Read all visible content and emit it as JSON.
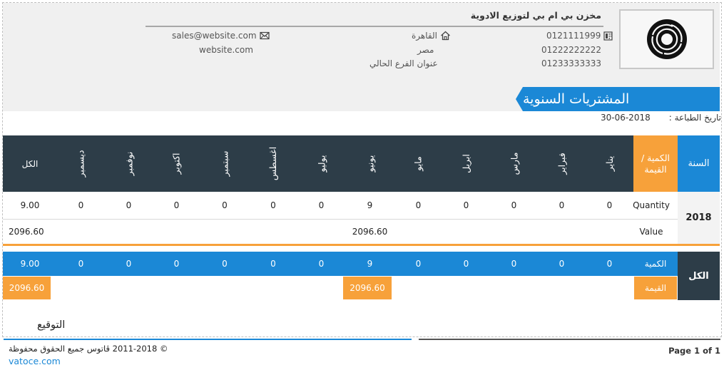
{
  "company": {
    "name": "مخزن بي ام بي لتوزيع الادوية",
    "phone1": "0121111999",
    "phone2": "01222222222",
    "phone3": "01233333333",
    "city": "القاهرة",
    "country": "مصر",
    "branch_address": "عنوان الفرع الحالي",
    "email": "sales@website.com",
    "website": "website.com"
  },
  "report": {
    "title": "المشتريات السنوية",
    "print_date_label": "تاريخ الطباعة :",
    "print_date": "30-06-2018"
  },
  "table": {
    "year_header": "السنة",
    "qv_header": "الكمية / القيمة",
    "months": [
      "يناير",
      "فبراير",
      "مارس",
      "ابريل",
      "مايو",
      "يونيو",
      "يوليو",
      "اغسطس",
      "سبتمبر",
      "اكتوبر",
      "نوفمبر",
      "ديسمبر"
    ],
    "total_header": "الكل",
    "year": "2018",
    "quantity_label": "Quantity",
    "value_label": "Value",
    "quantity": [
      "0",
      "0",
      "0",
      "0",
      "0",
      "9",
      "0",
      "0",
      "0",
      "0",
      "0",
      "0"
    ],
    "quantity_total": "9.00",
    "value_june": "2096.60",
    "value_total": "2096.60"
  },
  "totals": {
    "label": "الكل",
    "quantity_label": "الكمية",
    "value_label": "القيمة",
    "quantity": [
      "0",
      "0",
      "0",
      "0",
      "0",
      "9",
      "0",
      "0",
      "0",
      "0",
      "0",
      "0"
    ],
    "quantity_total": "9.00",
    "value_june": "2096.60",
    "value_total": "2096.60"
  },
  "signature_label": "التوقيع",
  "footer": {
    "copyright": "© 2011-2018 ڤاتوس جميع الحقوق محفوظة",
    "link": "vatoce.com",
    "page": "Page 1 of 1"
  },
  "colors": {
    "blue": "#1b88d6",
    "dark": "#2d3d48",
    "orange": "#f7a13a"
  }
}
